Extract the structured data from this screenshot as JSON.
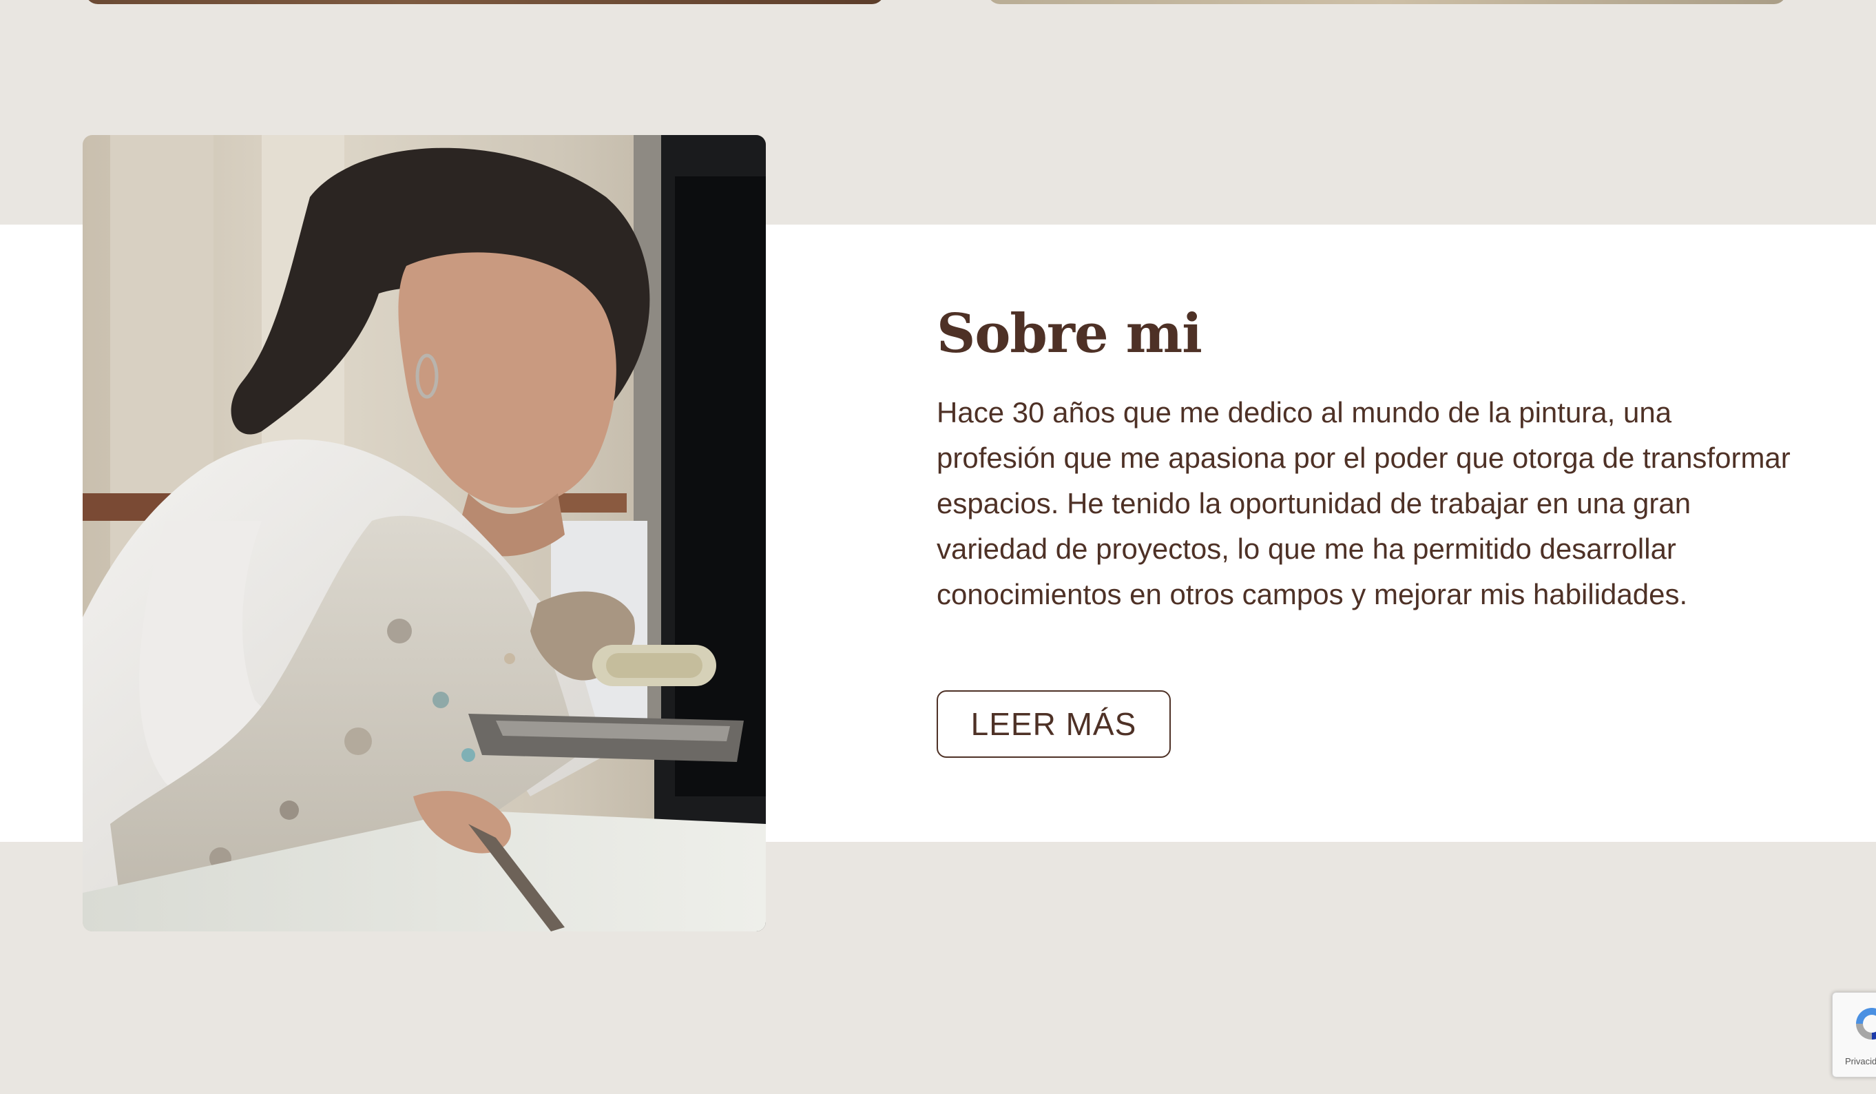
{
  "about": {
    "title": "Sobre mi",
    "body": "Hace 30 años que me dedico al mundo de la pintura, una profesión que me apasiona por el poder que otorga de transformar espacios. He tenido la oportunidad de trabajar en una gran variedad de proyectos, lo que me ha permitido desarrollar conocimientos en otros campos y mejorar mis habilidades.",
    "button_label": "LEER MÁS"
  },
  "recaptcha": {
    "privacy_label": "Privacidad",
    "icon": "recaptcha-icon"
  },
  "colors": {
    "page_background": "#e9e6e1",
    "band_background": "#ffffff",
    "text": "#4e3126"
  }
}
